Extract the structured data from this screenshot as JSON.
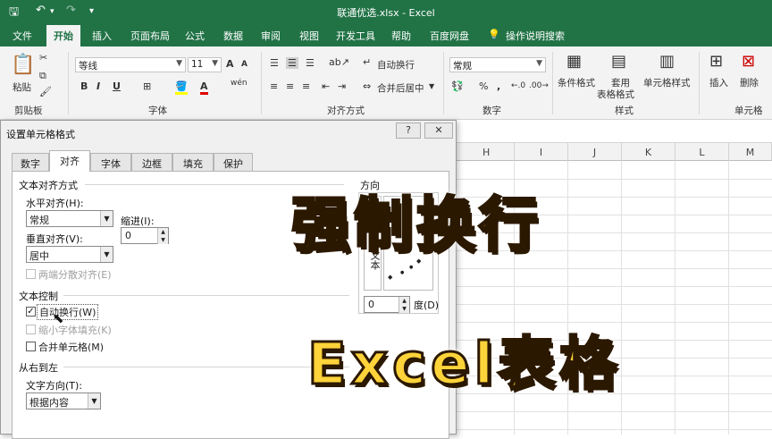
{
  "window": {
    "title": "联通优选.xlsx - Excel"
  },
  "ribbon_tabs": [
    "文件",
    "开始",
    "插入",
    "页面布局",
    "公式",
    "数据",
    "审阅",
    "视图",
    "开发工具",
    "帮助",
    "百度网盘",
    "操作说明搜索"
  ],
  "ribbon": {
    "paste_label": "粘贴",
    "font_name": "等线",
    "font_size": "11",
    "grow_font": "A",
    "shrink_font": "A",
    "bold": "B",
    "italic": "I",
    "underline": "U",
    "wrap_text": "自动换行",
    "merge_center": "合并后居中",
    "number_format": "常规",
    "percent": "%",
    "comma": ",",
    "cond_format": "条件格式",
    "table_format_1": "套用",
    "table_format_2": "表格格式",
    "cell_style": "单元格样式",
    "insert": "插入",
    "delete": "删除",
    "groups": {
      "clipboard": "剪贴板",
      "font": "字体",
      "alignment": "对齐方式",
      "number": "数字",
      "styles": "样式",
      "cells": "单元格"
    }
  },
  "columns": [
    "H",
    "I",
    "J",
    "K",
    "L",
    "M"
  ],
  "dialog": {
    "title": "设置单元格格式",
    "help_button": "?",
    "close_button": "✕",
    "tabs": [
      "数字",
      "对齐",
      "字体",
      "边框",
      "填充",
      "保护"
    ],
    "active_tab": "对齐",
    "text_alignment_section": "文本对齐方式",
    "horizontal_label": "水平对齐(H):",
    "horizontal_value": "常规",
    "indent_label": "缩进(I):",
    "indent_value": "0",
    "vertical_label": "垂直对齐(V):",
    "vertical_value": "居中",
    "justify_distributed": "两端分散对齐(E)",
    "text_control_section": "文本控制",
    "wrap_text": "自动换行(W)",
    "wrap_text_checked": true,
    "shrink_to_fit": "缩小字体填充(K)",
    "merge_cells": "合并单元格(M)",
    "rtl_section": "从右到左",
    "text_direction_label": "文字方向(T):",
    "text_direction_value": "根据内容",
    "orientation_section": "方向",
    "orientation_vertical_text": "文本",
    "degrees_value": "0",
    "degrees_label": "度(D)"
  },
  "overlay": {
    "line1": "强制换行",
    "line2": "Excel表格",
    "color": "#ffd33a"
  },
  "colors": {
    "excel_green": "#217346"
  }
}
